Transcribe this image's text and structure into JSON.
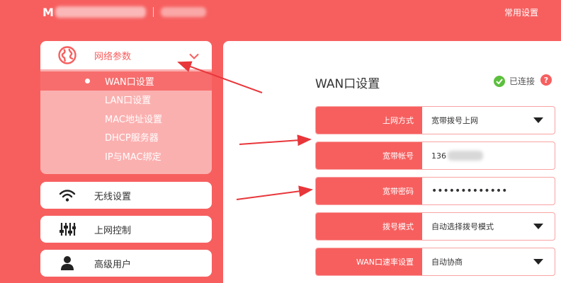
{
  "header": {
    "brand_visible": "M",
    "shortcut_link": "常用设置"
  },
  "sidebar": {
    "network": {
      "label": "网络参数",
      "icon": "globe-icon",
      "expanded": true,
      "items": [
        {
          "label": "WAN口设置",
          "active": true
        },
        {
          "label": "LAN口设置"
        },
        {
          "label": "MAC地址设置"
        },
        {
          "label": "DHCP服务器"
        },
        {
          "label": "IP与MAC绑定"
        }
      ]
    },
    "wireless": {
      "label": "无线设置",
      "icon": "wifi-icon"
    },
    "access_control": {
      "label": "上网控制",
      "icon": "sliders-icon"
    },
    "advanced": {
      "label": "高级用户",
      "icon": "user-icon"
    }
  },
  "main": {
    "title": "WAN口设置",
    "status_text": "已连接",
    "help_glyph": "?",
    "fields": [
      {
        "label": "上网方式",
        "value": "宽带拨号上网",
        "type": "select"
      },
      {
        "label": "宽带帐号",
        "value": "136",
        "type": "text"
      },
      {
        "label": "宽带密码",
        "value": "•••••••••••••",
        "type": "password"
      },
      {
        "label": "拨号模式",
        "value": "自动选择拨号模式",
        "type": "select"
      },
      {
        "label": "WAN口速率设置",
        "value": "自动协商",
        "type": "select"
      }
    ]
  },
  "colors": {
    "brand_red": "#f75f5f",
    "submenu_bg": "#fbb0b0",
    "connected_green": "#5cbf3d",
    "annotation_arrow": "#e8363a"
  }
}
